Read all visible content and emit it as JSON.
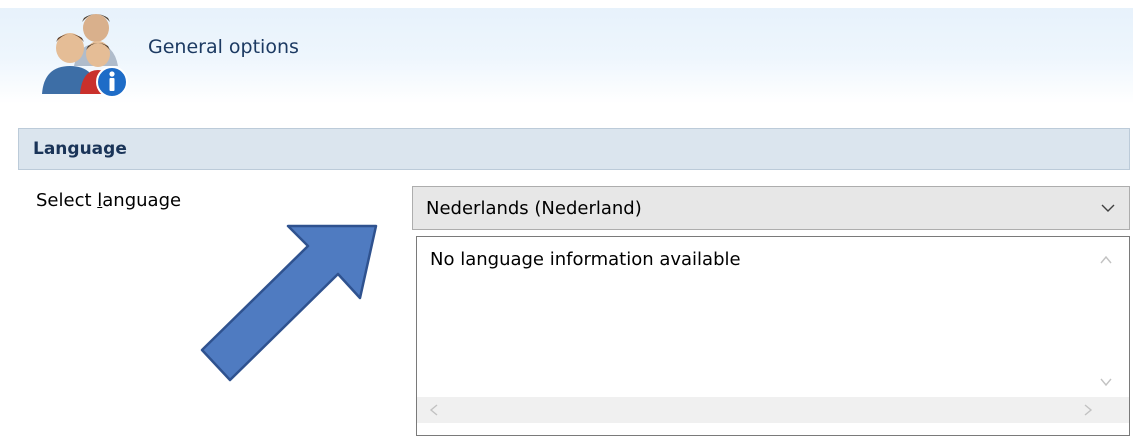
{
  "header": {
    "title": "General options",
    "icon": "users-info-icon"
  },
  "section": {
    "title": "Language"
  },
  "language": {
    "label_before": "Select ",
    "label_accel": "l",
    "label_after": "anguage",
    "selected": "Nederlands (Nederland)",
    "info": "No language information available"
  },
  "colors": {
    "header_text": "#1c3a62",
    "section_bg": "#dbe5ee",
    "arrow_fill": "#4f7bc1",
    "arrow_stroke": "#2f528f"
  }
}
